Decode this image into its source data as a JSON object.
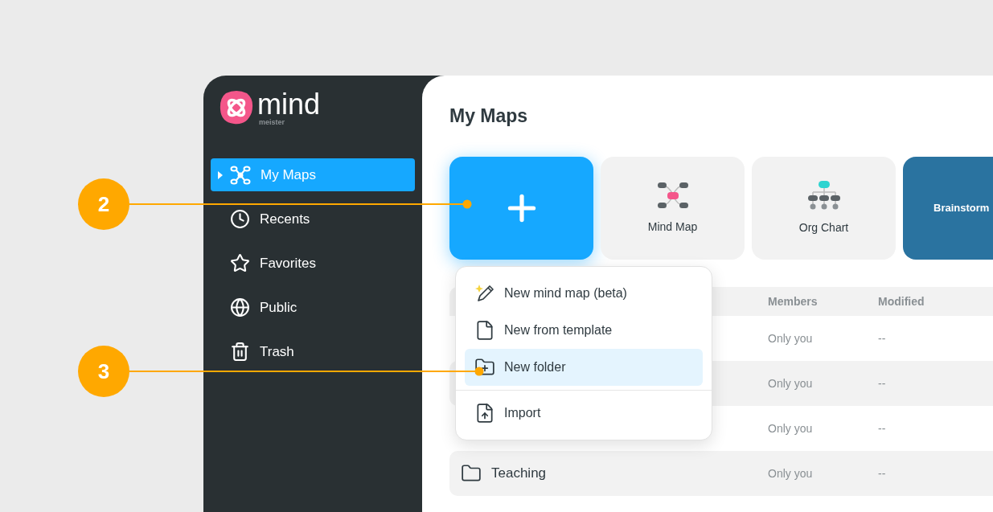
{
  "logo": {
    "word": "mind",
    "sub": "meister"
  },
  "sidebar": {
    "items": [
      {
        "label": "My Maps",
        "kind": "map",
        "selected": true
      },
      {
        "label": "Recents",
        "kind": "clock",
        "selected": false
      },
      {
        "label": "Favorites",
        "kind": "star",
        "selected": false
      },
      {
        "label": "Public",
        "kind": "globe",
        "selected": false
      },
      {
        "label": "Trash",
        "kind": "trash",
        "selected": false
      }
    ]
  },
  "page_title": "My Maps",
  "cards": [
    {
      "kind": "new"
    },
    {
      "kind": "mindmap",
      "label": "Mind Map"
    },
    {
      "kind": "orgchart",
      "label": "Org Chart"
    },
    {
      "kind": "brainstorm",
      "label": "Brainstorm"
    }
  ],
  "table": {
    "columns": [
      "Members",
      "Modified"
    ],
    "rows": [
      {
        "members": "Only you",
        "modified": "--"
      },
      {
        "members": "Only you",
        "modified": "--"
      },
      {
        "members": "Only you",
        "modified": "--"
      },
      {
        "name": "Teaching",
        "members": "Only you",
        "modified": "--"
      }
    ]
  },
  "menu": {
    "items": [
      {
        "kind": "ai",
        "label": "New mind map (beta)",
        "selected": false
      },
      {
        "kind": "template",
        "label": "New from template",
        "selected": false
      },
      {
        "kind": "folder",
        "label": "New folder",
        "selected": true
      },
      {
        "kind": "divider"
      },
      {
        "kind": "import",
        "label": "Import",
        "selected": false
      }
    ]
  },
  "callouts": [
    {
      "label": "2"
    },
    {
      "label": "3"
    }
  ]
}
